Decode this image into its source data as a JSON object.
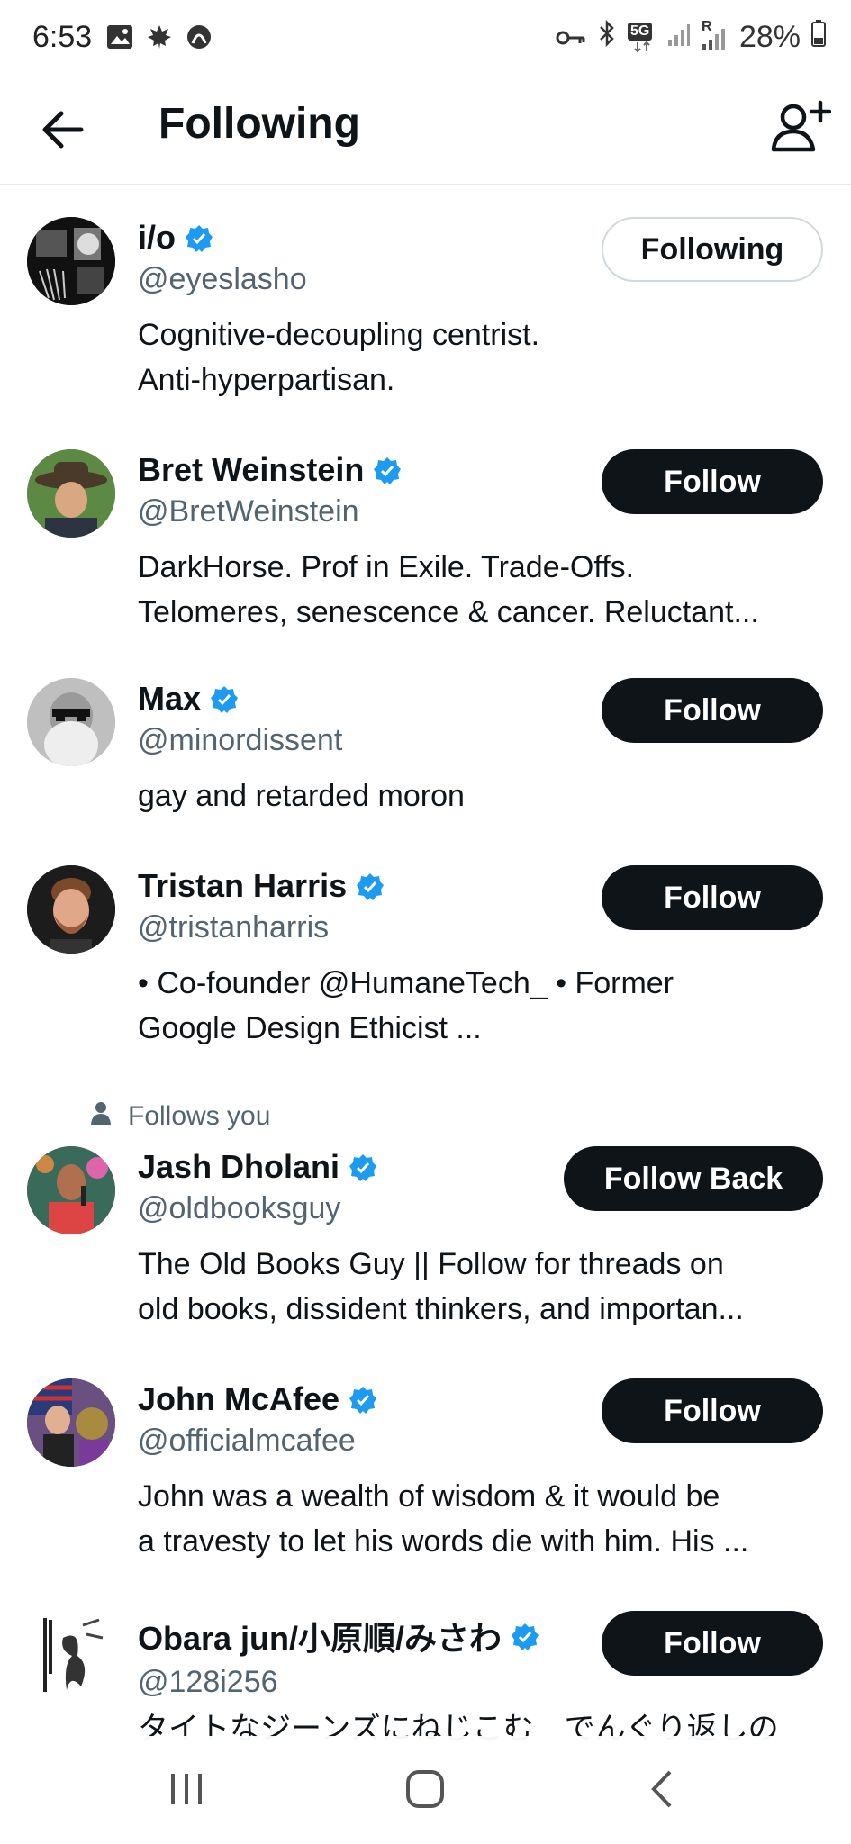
{
  "status_bar": {
    "time": "6:53",
    "battery": "28%",
    "left_icons": [
      "gallery-icon",
      "maple-leaf-icon",
      "app-icon"
    ],
    "right_icons": [
      "vpn-key-icon",
      "bluetooth-icon",
      "5g-icon",
      "signal-icon",
      "signal-roaming-icon",
      "battery-icon"
    ],
    "network_label": "5G",
    "roaming_label": "R"
  },
  "header": {
    "title": "Following",
    "back_icon": "back-arrow-icon",
    "add_icon": "add-user-icon"
  },
  "accounts": [
    {
      "name": "i/o",
      "handle": "@eyeslasho",
      "verified": true,
      "button": "Following",
      "bio_lines": [
        "Cognitive-decoupling centrist.",
        "Anti-hyperpartisan."
      ]
    },
    {
      "name": "Bret Weinstein",
      "handle": "@BretWeinstein",
      "verified": true,
      "button": "Follow",
      "bio_lines": [
        "DarkHorse. Prof in Exile. Trade-Offs.",
        "Telomeres, senescence & cancer. Reluctant..."
      ]
    },
    {
      "name": "Max",
      "handle": "@minordissent",
      "verified": true,
      "button": "Follow",
      "bio_lines": [
        "gay and retarded moron"
      ]
    },
    {
      "name": "Tristan Harris",
      "handle": "@tristanharris",
      "verified": true,
      "button": "Follow",
      "bio_lines": [
        "• Co-founder @HumaneTech_ • Former",
        "Google Design Ethicist ..."
      ]
    },
    {
      "name": "Jash Dholani",
      "handle": "@oldbooksguy",
      "verified": true,
      "button": "Follow Back",
      "follows_you": "Follows you",
      "bio_lines": [
        "The Old Books Guy || Follow for threads on",
        "old books, dissident thinkers, and importan..."
      ]
    },
    {
      "name": "John McAfee",
      "handle": "@officialmcafee",
      "verified": true,
      "button": "Follow",
      "bio_lines": [
        "John was a wealth of wisdom & it would be",
        "a travesty to let his words die with him. His ..."
      ]
    },
    {
      "name": "Obara jun/小原順/みさわ",
      "handle": "@128i256",
      "verified": true,
      "button": "Follow",
      "bio_lines": [
        "タイトなジーンズにねじこむ　でんぐり返しの"
      ]
    }
  ],
  "colors": {
    "verified": "#1d9bf0",
    "text": "#0f1419",
    "muted": "#536471",
    "button_dark": "#0f1419"
  },
  "nav_bar": {
    "icons": [
      "recent-apps-icon",
      "home-icon",
      "back-icon"
    ]
  }
}
